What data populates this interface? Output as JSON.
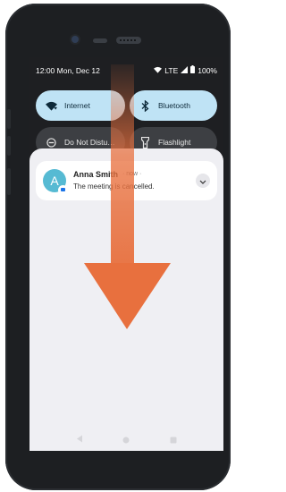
{
  "status_bar": {
    "time": "12:00 Mon, Dec 12",
    "network": "LTE",
    "battery": "100%"
  },
  "quick_settings": {
    "tiles": [
      {
        "label": "Internet",
        "icon": "wifi-icon",
        "state": "on"
      },
      {
        "label": "Bluetooth",
        "icon": "bluetooth-icon",
        "state": "on"
      },
      {
        "label": "Do Not Distu…",
        "icon": "do-not-disturb-icon",
        "state": "off"
      },
      {
        "label": "Flashlight",
        "icon": "flashlight-icon",
        "state": "off"
      }
    ]
  },
  "notification": {
    "avatar_letter": "A",
    "sender": "Anna Smith",
    "time": "· now ·",
    "message": "The meeting is cancelled."
  },
  "colors": {
    "tile_on": "#bfe3f5",
    "tile_off": "#3d3f43",
    "avatar": "#56bad3",
    "arrow": "#e8703e"
  }
}
